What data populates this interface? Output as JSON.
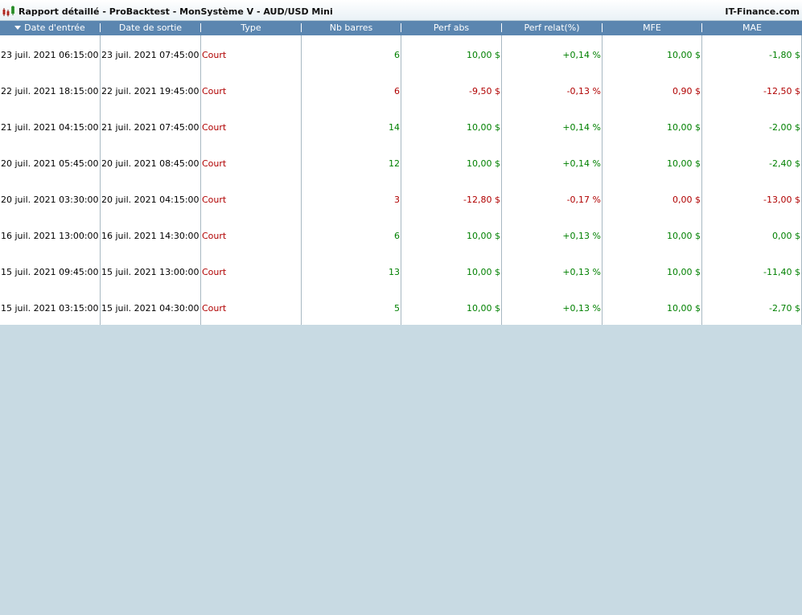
{
  "window": {
    "title": "Rapport détaillé - ProBacktest - MonSystème V - AUD/USD Mini",
    "brand": "IT-Finance.com",
    "icon": "candlestick-chart-icon"
  },
  "colors": {
    "header_bg": "#5b86b0",
    "positive": "#008000",
    "negative": "#b00000",
    "background": "#c8dae3"
  },
  "columns": [
    "Date d'entrée",
    "Date de sortie",
    "Type",
    "Nb barres",
    "Perf abs",
    "Perf relat(%)",
    "MFE",
    "MAE"
  ],
  "sort": {
    "column": "Date d'entrée",
    "direction": "descending",
    "icon": "sort-down-triangle-icon"
  },
  "rows": [
    {
      "entry": "23 juil. 2021 06:15:00",
      "exit": "23 juil. 2021 07:45:00",
      "type": "Court",
      "bars": "6",
      "perf_abs": "10,00 $",
      "perf_rel": "+0,14 %",
      "mfe": "10,00 $",
      "mae": "-1,80 $",
      "sign": "pos"
    },
    {
      "entry": "22 juil. 2021 18:15:00",
      "exit": "22 juil. 2021 19:45:00",
      "type": "Court",
      "bars": "6",
      "perf_abs": "-9,50 $",
      "perf_rel": "-0,13 %",
      "mfe": "0,90 $",
      "mae": "-12,50 $",
      "sign": "neg"
    },
    {
      "entry": "21 juil. 2021 04:15:00",
      "exit": "21 juil. 2021 07:45:00",
      "type": "Court",
      "bars": "14",
      "perf_abs": "10,00 $",
      "perf_rel": "+0,14 %",
      "mfe": "10,00 $",
      "mae": "-2,00 $",
      "sign": "pos"
    },
    {
      "entry": "20 juil. 2021 05:45:00",
      "exit": "20 juil. 2021 08:45:00",
      "type": "Court",
      "bars": "12",
      "perf_abs": "10,00 $",
      "perf_rel": "+0,14 %",
      "mfe": "10,00 $",
      "mae": "-2,40 $",
      "sign": "pos"
    },
    {
      "entry": "20 juil. 2021 03:30:00",
      "exit": "20 juil. 2021 04:15:00",
      "type": "Court",
      "bars": "3",
      "perf_abs": "-12,80 $",
      "perf_rel": "-0,17 %",
      "mfe": "0,00 $",
      "mae": "-13,00 $",
      "sign": "neg"
    },
    {
      "entry": "16 juil. 2021 13:00:00",
      "exit": "16 juil. 2021 14:30:00",
      "type": "Court",
      "bars": "6",
      "perf_abs": "10,00 $",
      "perf_rel": "+0,13 %",
      "mfe": "10,00 $",
      "mae": "0,00 $",
      "sign": "pos"
    },
    {
      "entry": "15 juil. 2021 09:45:00",
      "exit": "15 juil. 2021 13:00:00",
      "type": "Court",
      "bars": "13",
      "perf_abs": "10,00 $",
      "perf_rel": "+0,13 %",
      "mfe": "10,00 $",
      "mae": "-11,40 $",
      "sign": "pos"
    },
    {
      "entry": "15 juil. 2021 03:15:00",
      "exit": "15 juil. 2021 04:30:00",
      "type": "Court",
      "bars": "5",
      "perf_abs": "10,00 $",
      "perf_rel": "+0,13 %",
      "mfe": "10,00 $",
      "mae": "-2,70 $",
      "sign": "pos"
    }
  ]
}
